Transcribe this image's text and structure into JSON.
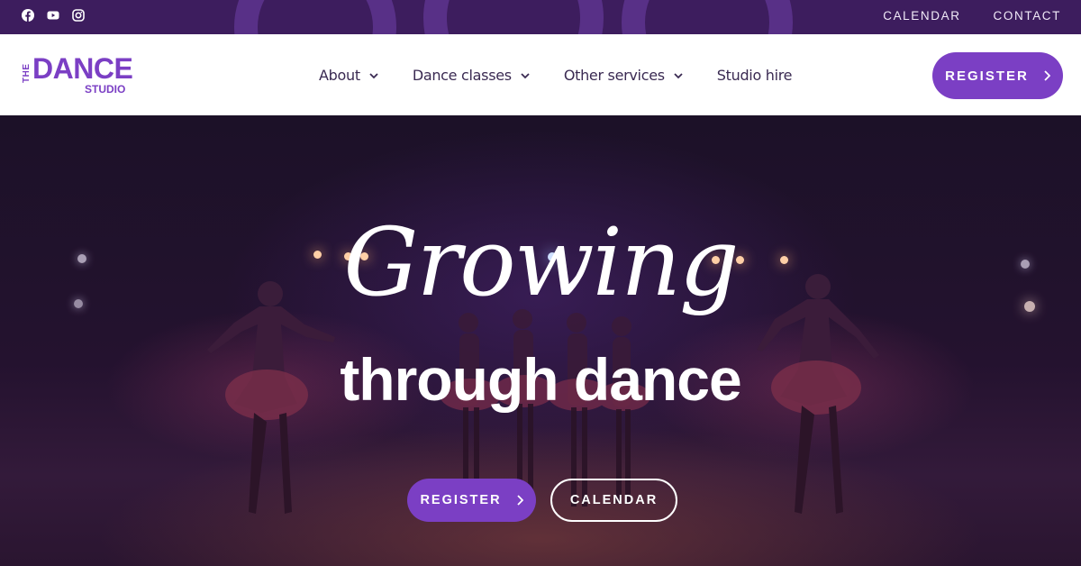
{
  "topbar": {
    "social_icons": [
      "facebook-icon",
      "youtube-icon",
      "instagram-icon"
    ],
    "links": [
      {
        "label": "CALENDAR"
      },
      {
        "label": "CONTACT"
      }
    ]
  },
  "logo": {
    "the": "THE",
    "dance": "DANCE",
    "studio": "STUDIO"
  },
  "nav": {
    "items": [
      {
        "label": "About",
        "has_dropdown": true
      },
      {
        "label": "Dance classes",
        "has_dropdown": true
      },
      {
        "label": "Other services",
        "has_dropdown": true
      },
      {
        "label": "Studio hire",
        "has_dropdown": false
      }
    ],
    "register_label": "REGISTER"
  },
  "hero": {
    "headline_script": "Growing",
    "headline_main": "through dance",
    "register_label": "REGISTER",
    "calendar_label": "CALENDAR"
  },
  "colors": {
    "brand_purple": "#7b3fc4",
    "topbar_bg": "#3d1d5e",
    "nav_text": "#3a2a52"
  }
}
